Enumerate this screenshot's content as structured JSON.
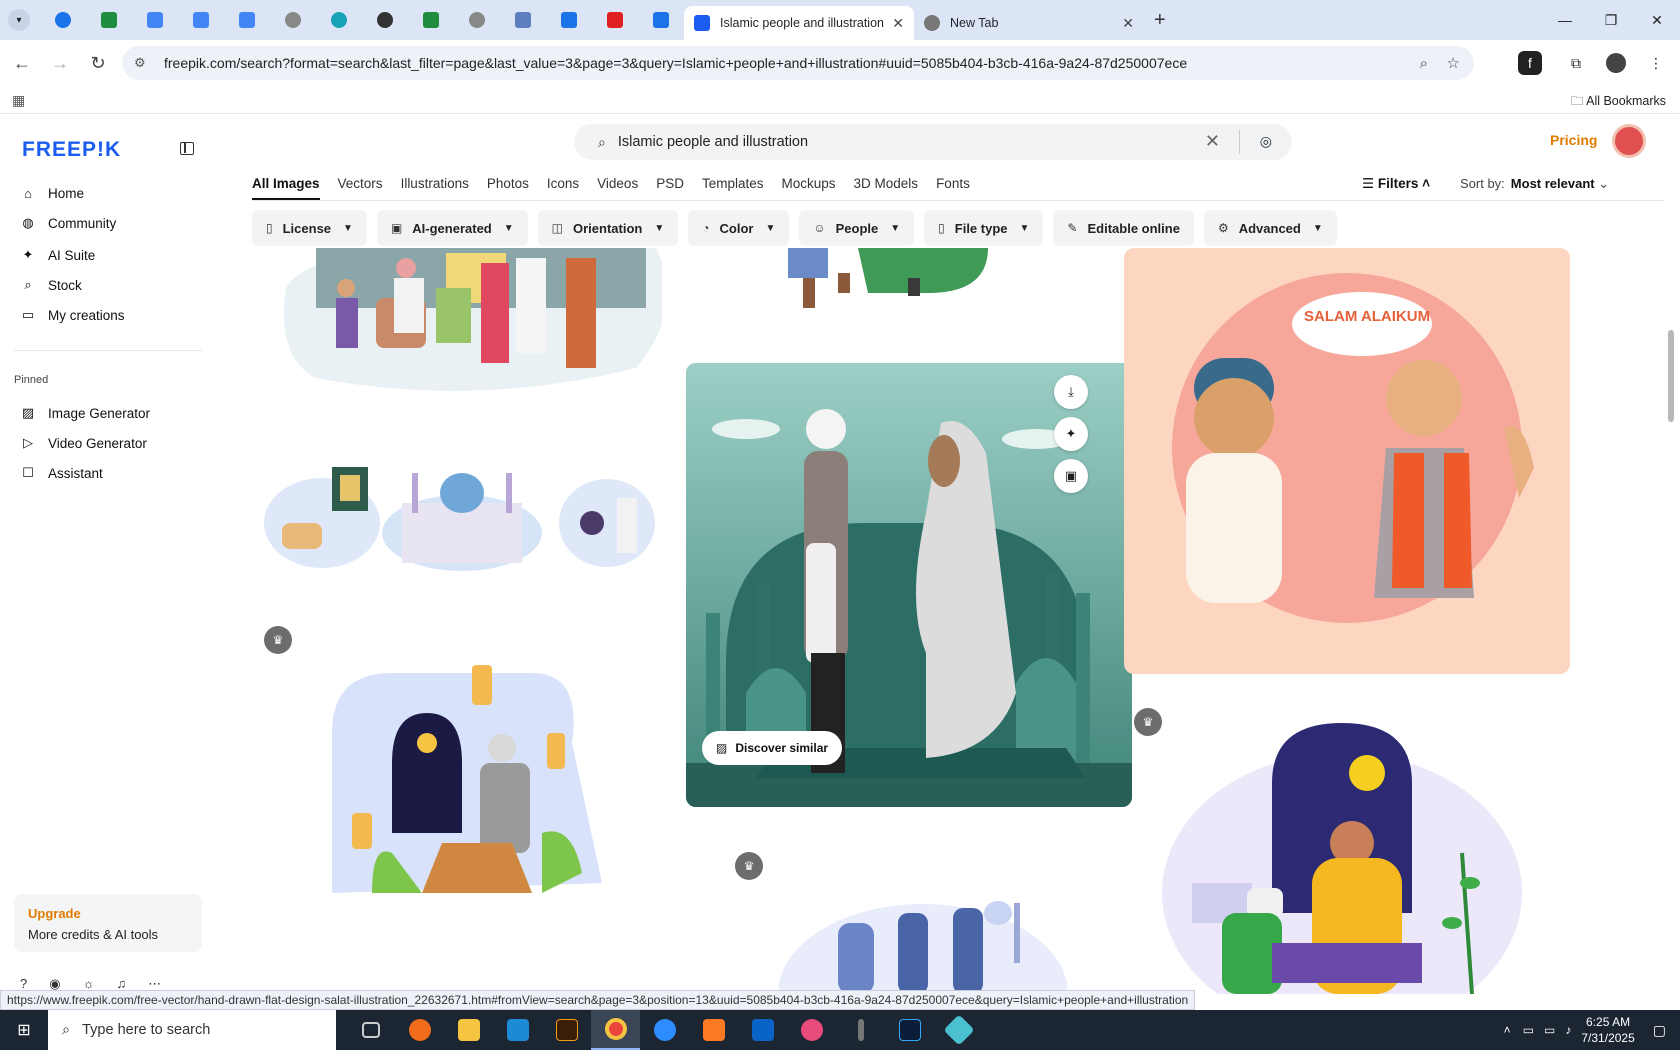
{
  "browser": {
    "tabs": [
      {
        "title": "Islamic people and illustration v",
        "active": true
      },
      {
        "title": "New Tab",
        "active": false
      }
    ],
    "url": "freepik.com/search?format=search&last_filter=page&last_value=3&page=3&query=Islamic+people+and+illustration#uuid=5085b404-b3cb-416a-9a24-87d250007ece",
    "all_bookmarks": "All Bookmarks"
  },
  "sidebar": {
    "logo": "FREEP!K",
    "nav": [
      {
        "label": "Home",
        "icon": "home-icon"
      },
      {
        "label": "Community",
        "icon": "globe-icon"
      },
      {
        "label": "AI Suite",
        "icon": "sparkle-icon"
      },
      {
        "label": "Stock",
        "icon": "search-icon"
      },
      {
        "label": "My creations",
        "icon": "folder-icon"
      }
    ],
    "pinned_label": "Pinned",
    "pinned": [
      {
        "label": "Image Generator",
        "icon": "image-icon"
      },
      {
        "label": "Video Generator",
        "icon": "video-icon"
      },
      {
        "label": "Assistant",
        "icon": "chat-icon"
      }
    ],
    "upgrade": {
      "title": "Upgrade",
      "subtitle": "More credits & AI tools"
    }
  },
  "header": {
    "search_value": "Islamic people and illustration",
    "pricing": "Pricing"
  },
  "categories": [
    "All Images",
    "Vectors",
    "Illustrations",
    "Photos",
    "Icons",
    "Videos",
    "PSD",
    "Templates",
    "Mockups",
    "3D Models",
    "Fonts"
  ],
  "active_category": "All Images",
  "filters_label": "Filters",
  "sort": {
    "label": "Sort by:",
    "value": "Most relevant"
  },
  "chips": [
    {
      "label": "License",
      "icon": "license-icon"
    },
    {
      "label": "AI-generated",
      "icon": "ai-icon"
    },
    {
      "label": "Orientation",
      "icon": "orientation-icon"
    },
    {
      "label": "Color",
      "icon": "palette-icon"
    },
    {
      "label": "People",
      "icon": "people-icon"
    },
    {
      "label": "File type",
      "icon": "file-icon"
    },
    {
      "label": "Editable online",
      "icon": "pencil-icon"
    },
    {
      "label": "Advanced",
      "icon": "gear-icon"
    }
  ],
  "cards": {
    "greeting_text": "SALAM ALAIKUM",
    "discover_similar": "Discover similar"
  },
  "status_url": "https://www.freepik.com/free-vector/hand-drawn-flat-design-salat-illustration_22632671.htm#fromView=search&page=3&position=13&uuid=5085b404-b3cb-416a-9a24-87d250007ece&query=Islamic+people+and+illustration",
  "taskbar": {
    "search_placeholder": "Type here to search",
    "time": "6:25 AM",
    "date": "7/31/2025"
  }
}
